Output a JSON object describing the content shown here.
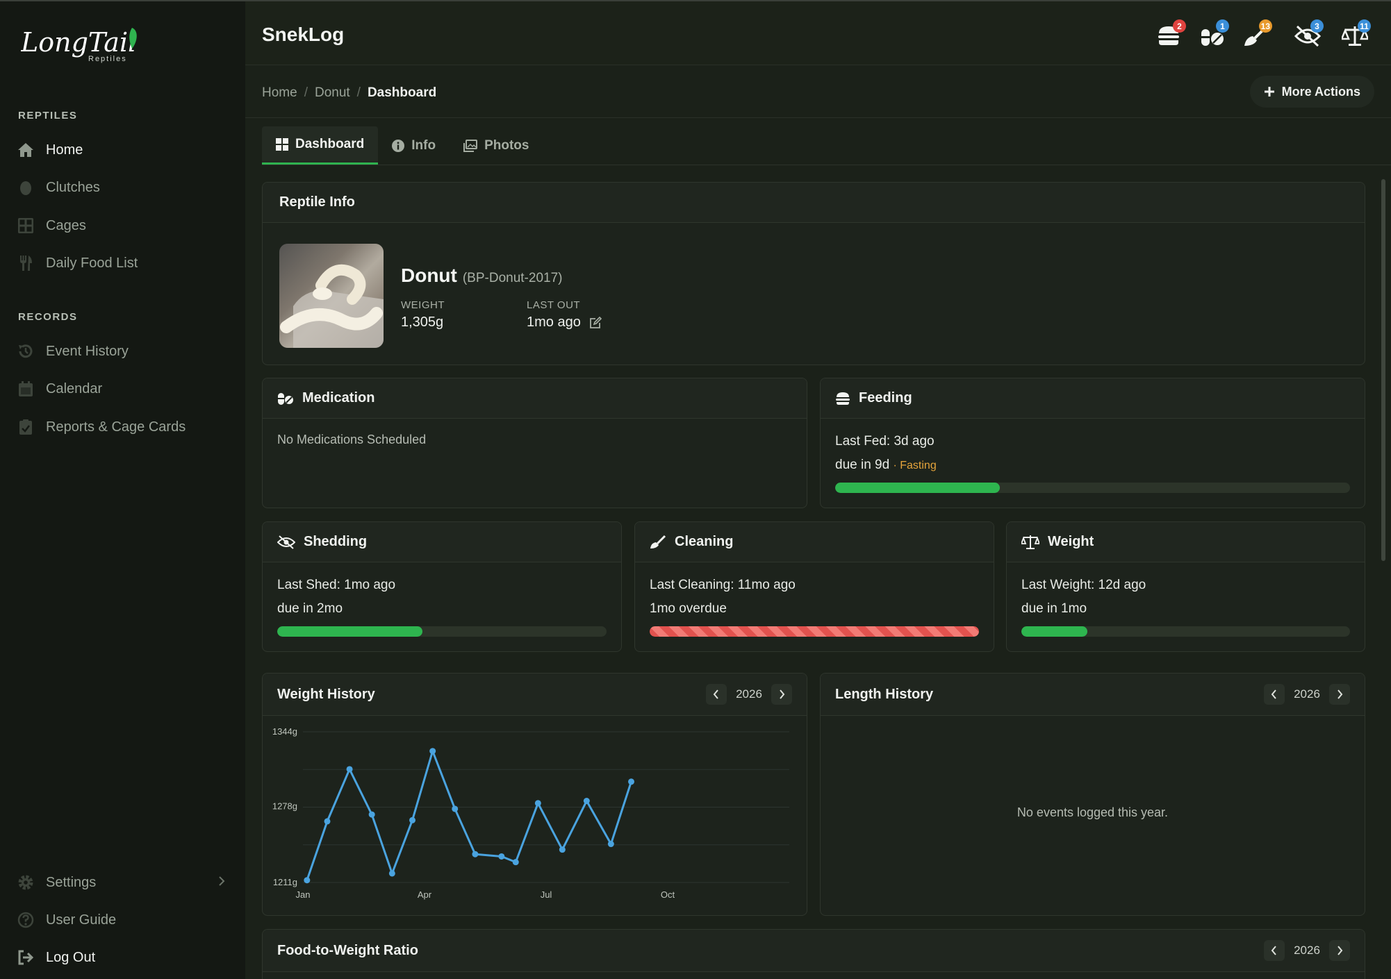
{
  "brand": {
    "logo_text": "LongTail",
    "logo_sub": "Reptiles"
  },
  "sidebar": {
    "sections": [
      {
        "heading": "REPTILES",
        "items": [
          {
            "label": "Home",
            "icon": "home-icon"
          },
          {
            "label": "Clutches",
            "icon": "egg-icon"
          },
          {
            "label": "Cages",
            "icon": "grid-icon"
          },
          {
            "label": "Daily Food List",
            "icon": "utensils-icon"
          }
        ]
      },
      {
        "heading": "RECORDS",
        "items": [
          {
            "label": "Event History",
            "icon": "history-icon"
          },
          {
            "label": "Calendar",
            "icon": "calendar-icon"
          },
          {
            "label": "Reports & Cage Cards",
            "icon": "clipboard-check-icon"
          }
        ]
      }
    ],
    "footer": [
      {
        "label": "Settings",
        "icon": "gear-icon"
      },
      {
        "label": "User Guide",
        "icon": "question-icon"
      },
      {
        "label": "Log Out",
        "icon": "logout-icon"
      }
    ]
  },
  "header": {
    "title": "SnekLog",
    "alerts": [
      {
        "icon": "burger-icon",
        "count": "2",
        "color": "#e0433f"
      },
      {
        "icon": "pills-icon",
        "count": "1",
        "color": "#3b8fd9"
      },
      {
        "icon": "broom-icon",
        "count": "13",
        "color": "#e89a2c"
      },
      {
        "icon": "eye-slash-icon",
        "count": "3",
        "color": "#3b8fd9"
      },
      {
        "icon": "scale-icon",
        "count": "11",
        "color": "#3b8fd9"
      }
    ]
  },
  "breadcrumb": {
    "items": [
      "Home",
      "Donut",
      "Dashboard"
    ]
  },
  "more_actions": {
    "label": "More Actions"
  },
  "tabs": [
    {
      "label": "Dashboard",
      "icon": "dashboard-icon"
    },
    {
      "label": "Info",
      "icon": "info-icon"
    },
    {
      "label": "Photos",
      "icon": "photos-icon"
    }
  ],
  "reptile_info": {
    "title": "Reptile Info",
    "name": "Donut",
    "code": "(BP-Donut-2017)",
    "weight_label": "WEIGHT",
    "weight": "1,305g",
    "lastout_label": "LAST OUT",
    "lastout": "1mo ago"
  },
  "medication": {
    "title": "Medication",
    "empty": "No Medications Scheduled"
  },
  "feeding": {
    "title": "Feeding",
    "last": "Last Fed: 3d ago",
    "due": "due in 9d",
    "status": "· Fasting",
    "progress": 0.32
  },
  "shedding": {
    "title": "Shedding",
    "last": "Last Shed: 1mo ago",
    "due": "due in 2mo",
    "progress": 0.44
  },
  "cleaning": {
    "title": "Cleaning",
    "last": "Last Cleaning: 11mo ago",
    "due": "1mo overdue",
    "progress": 1.0
  },
  "weight_card": {
    "title": "Weight",
    "last": "Last Weight: 12d ago",
    "due": "due in 1mo",
    "progress": 0.2
  },
  "weight_history": {
    "title": "Weight History",
    "year": "2026"
  },
  "length_history": {
    "title": "Length History",
    "year": "2026",
    "empty": "No events logged this year."
  },
  "food_ratio": {
    "title": "Food-to-Weight Ratio",
    "year": "2026"
  },
  "chart_data": {
    "type": "line",
    "title": "Weight History",
    "ytick_labels": [
      "1344g",
      "1278g",
      "1211g"
    ],
    "yticks": [
      1344,
      1278,
      1211
    ],
    "ylim": [
      1211,
      1344
    ],
    "xtick_labels": [
      "Jan",
      "Apr",
      "Jul",
      "Oct"
    ],
    "xticks": [
      1,
      4,
      7,
      10
    ],
    "xlim": [
      1,
      13
    ],
    "color": "#4aa3df",
    "series": [
      {
        "x": [
          1.1,
          1.6,
          2.15,
          2.7,
          3.2,
          3.7,
          4.2,
          4.75,
          5.25,
          5.9,
          6.25,
          6.8,
          7.4,
          8.0,
          8.6,
          9.1
        ],
        "y": [
          1213,
          1265,
          1311,
          1271,
          1219,
          1266,
          1327,
          1276,
          1236,
          1234,
          1229,
          1281,
          1240,
          1283,
          1245,
          1300
        ]
      }
    ]
  }
}
